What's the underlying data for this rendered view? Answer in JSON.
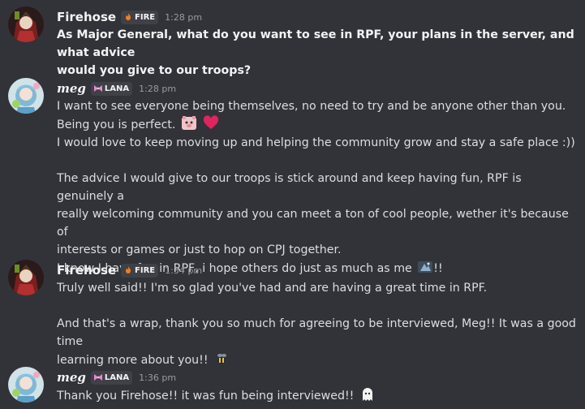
{
  "messages": [
    {
      "author": "Firehose",
      "tag": "FIRE",
      "tag_icon": "fire-icon",
      "time": "1:28 pm",
      "lines": [
        "As Major General, what do you want to see in RPF, your plans in the server, and what advice",
        "would you give to our troops?"
      ]
    },
    {
      "author": "meg",
      "tag": "LANA",
      "tag_icon": "bow-icon",
      "time": "1:28 pm",
      "lines": [
        "I want to see everyone being themselves, no need to try and be anyone other than you.",
        "Being you is perfect.",
        "I would love to keep moving up and helping the community grow and stay a safe place :))",
        "The advice I would give to our troops is stick around and keep having fun, RPF is genuinely a",
        "really welcoming community and you can meet a ton of cool people, wether it's because of",
        "interests or games or just to hop on CPJ together.",
        "I know I have fun in RPF, i hope others do just as much as me",
        "!!"
      ]
    },
    {
      "author": "Firehose",
      "tag": "FIRE",
      "tag_icon": "fire-icon",
      "time": "1:34 pm",
      "lines": [
        "Truly well said!! I'm so glad you've had and are having a great time in RPF.",
        "And that's a wrap, thank you so much for agreeing to be interviewed, Meg!! It was a good time",
        "learning more about you!!"
      ]
    },
    {
      "author": "meg",
      "tag": "LANA",
      "tag_icon": "bow-icon",
      "time": "1:36 pm",
      "lines": [
        "Thank you Firehose!! it was fun being interviewed!!"
      ]
    }
  ],
  "colors": {
    "background": "#323339",
    "text": "#dbdee1",
    "author": "#f2f3f5",
    "timestamp": "#949ba4",
    "heart": "#e0245e"
  }
}
